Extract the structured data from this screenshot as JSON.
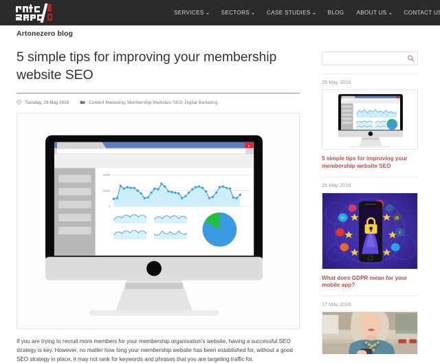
{
  "header": {
    "logo": {
      "line1": "art",
      "line2": "zero",
      "alt": "artonezero-logo"
    },
    "nav": [
      {
        "label": "SERVICES",
        "has_dropdown": true
      },
      {
        "label": "SECTORS",
        "has_dropdown": true
      },
      {
        "label": "CASE STUDIES",
        "has_dropdown": true
      },
      {
        "label": "BLOG",
        "has_dropdown": false
      },
      {
        "label": "ABOUT US",
        "has_dropdown": true
      },
      {
        "label": "CONTACT US",
        "has_dropdown": false
      }
    ],
    "background_color": "#2b2b2b",
    "accent_color": "#c1272d"
  },
  "subheader": {
    "title": "Artonezero blog"
  },
  "article": {
    "title": "5 simple tips for improving your membership website SEO",
    "date": "Tuesday, 29 May 2018",
    "categories": "Content Marketing, Membership Websites, SEO, Digital Marketing",
    "date_icon": "clock-icon",
    "category_icon": "folder-icon",
    "body": "If you are trying to recruit more members for your membership organisation's website, having a successful SEO strategy is key. However, no matter how long your membership website has been established for, without a good SEO strategy in place, it may not rank for keywords and phrases that you are targeting traffic for.",
    "hero_alt": "desktop-monitor-analytics-dashboard-illustration"
  },
  "sidebar": {
    "search": {
      "value": "",
      "placeholder": "",
      "icon": "search-icon"
    },
    "posts": [
      {
        "date": "29 May 2018",
        "title": "5 simple tips for improving your membership website SEO",
        "thumb_type": "monitor",
        "thumb_alt": "desktop-monitor-analytics-dashboard-thumbnail"
      },
      {
        "date": "25 May 2018",
        "title": "What does GDPR mean for your mobile app?",
        "thumb_type": "gdpr",
        "thumb_alt": "smartphone-padlock-gdpr-social-icons-thumbnail"
      },
      {
        "date": "17 May 2018",
        "title": "",
        "thumb_type": "woman",
        "thumb_alt": "woman-in-teal-blouse-holding-phone-thumbnail"
      }
    ],
    "link_color": "#b8514c",
    "date_color": "#9a9a9a"
  },
  "chart_data": {
    "type": "area",
    "title": "",
    "xlabel": "",
    "ylabel": "",
    "ylim": [
      0,
      2000
    ],
    "ytick_labels": [
      "2000",
      "1000",
      "0"
    ],
    "grid": true,
    "legend": false,
    "series": [
      {
        "name": "sessions",
        "values": [
          480,
          520,
          1330,
          1130,
          1230,
          1170,
          1180,
          900,
          700,
          520,
          560,
          880,
          1140,
          1080,
          1460,
          1240,
          930,
          840,
          770,
          740,
          530,
          640,
          880,
          1080,
          1210,
          1290,
          1180,
          960,
          530,
          620,
          900,
          1220,
          1280,
          1180,
          1120,
          600,
          540,
          760
        ]
      }
    ],
    "sparklines": [
      {
        "name": "spark-top-left",
        "values": [
          40,
          75,
          35,
          85,
          40,
          80,
          45,
          78,
          38
        ]
      },
      {
        "name": "spark-top-right",
        "values": [
          55,
          80,
          40,
          70,
          45,
          82,
          38,
          72,
          50
        ]
      },
      {
        "name": "spark-bottom-left",
        "values": [
          45,
          82,
          38,
          76,
          42,
          84,
          40,
          70,
          48
        ]
      },
      {
        "name": "spark-bottom-right",
        "values": [
          60,
          38,
          80,
          45,
          72,
          40,
          78,
          42,
          66
        ]
      }
    ],
    "pie": {
      "type": "pie",
      "labels": [
        "segment-a",
        "segment-b"
      ],
      "values": [
        82,
        18
      ],
      "colors": [
        "#3b9ae1",
        "#22c03a"
      ]
    },
    "colors": {
      "line": "#4a9bd4",
      "fill": "#cceefb",
      "axis_text": "#b08f6a"
    }
  },
  "browser_mock": {
    "titlebar_color": "#5b7fc4",
    "tab_color": "#d4d4d4",
    "close_label": "x",
    "close_color": "#e8232a"
  }
}
